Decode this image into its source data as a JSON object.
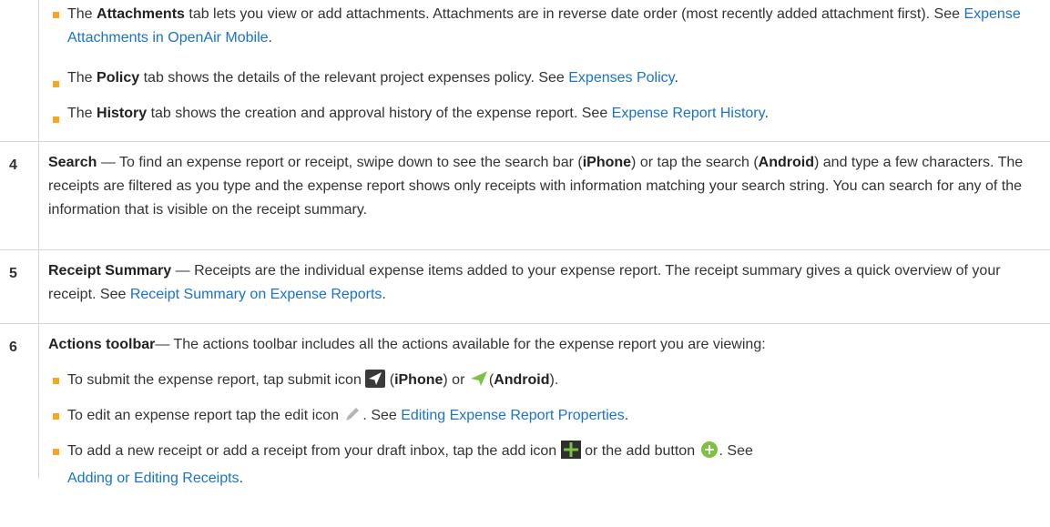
{
  "rows": {
    "r3": {
      "b1": {
        "lead": "The ",
        "bold": "Attachments",
        "text": " tab lets you view or add attachments. Attachments are in reverse date order (most recently added attachment first). See ",
        "link": "Expense Attachments in OpenAir Mobile",
        "tail": "."
      },
      "b2": {
        "lead": "The ",
        "bold": "Policy",
        "text": " tab shows the details of the relevant project expenses policy. See ",
        "link": "Expenses Policy",
        "tail": "."
      },
      "b3": {
        "lead": "The ",
        "bold": "History",
        "text": " tab shows the creation and approval history of the expense report. See ",
        "link": "Expense Report History",
        "tail": "."
      }
    },
    "r4": {
      "num": "4",
      "bold": "Search",
      "t1": " — To find an expense report or receipt, swipe down to see the search bar (",
      "b_iphone": "iPhone",
      "t2": ") or tap the search (",
      "b_android": "Android",
      "t3": ") and type a few characters. The receipts are filtered as you type and the expense report shows only receipts with information matching your search string. You can search for any of the information that is visible on the receipt summary."
    },
    "r5": {
      "num": "5",
      "bold": "Receipt Summary",
      "text": " — Receipts are the individual expense items added to your expense report. The receipt summary gives a quick overview of your receipt. See ",
      "link": "Receipt Summary on Expense Reports",
      "tail": "."
    },
    "r6": {
      "num": "6",
      "bold": "Actions toolbar",
      "text": "— The actions toolbar includes all the actions available for the expense report you are viewing:",
      "b1": {
        "t1": "To submit the expense report, tap submit icon ",
        "t2": " (",
        "bi": "iPhone",
        "t3": ") or ",
        "t4": "(",
        "ba": "Android",
        "t5": ")."
      },
      "b2": {
        "t1": "To edit an expense report tap the edit icon ",
        "t2": ". See ",
        "link": "Editing Expense Report Properties",
        "tail": "."
      },
      "b3": {
        "t1": "To add a new receipt or add a receipt from your draft inbox, tap the add icon ",
        "t2": " or the add button ",
        "t3": ". See ",
        "link": "Adding or Editing Receipts",
        "tail": "."
      }
    }
  },
  "colors": {
    "link": "#1a73c8",
    "bullet": "#f5a623",
    "icon_dark": "#3a3a3a",
    "icon_green": "#7cc242"
  },
  "icons": [
    "submit-iphone-icon",
    "submit-android-icon",
    "edit-icon",
    "add-icon",
    "add-button-icon"
  ]
}
